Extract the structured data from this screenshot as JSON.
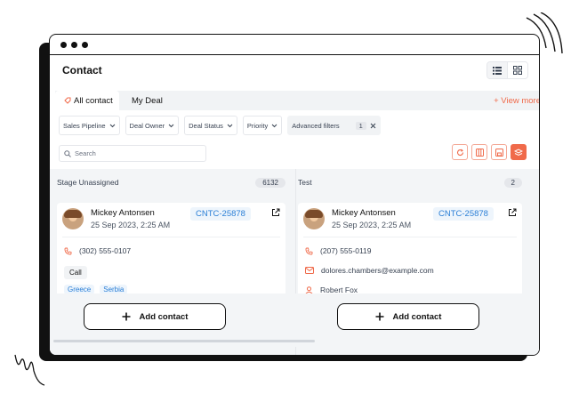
{
  "window": {
    "title": "Contact"
  },
  "tabs": [
    {
      "label": "All contact",
      "active": true
    },
    {
      "label": "My Deal",
      "active": false
    }
  ],
  "view_more": "+ View more",
  "filters": [
    {
      "label": "Sales Pipeline"
    },
    {
      "label": "Deal Owner"
    },
    {
      "label": "Deal Status"
    },
    {
      "label": "Priority"
    }
  ],
  "advanced_filters": {
    "label": "Advanced filters",
    "count": "1"
  },
  "search": {
    "placeholder": "Search"
  },
  "columns": [
    {
      "title": "Stage Unassigned",
      "count": "6132",
      "card": {
        "name": "Mickey Antonsen",
        "date": "25 Sep 2023, 2:25 AM",
        "id": "CNTC-25878",
        "phone": "(302) 555-0107",
        "chip": "Call",
        "tags": [
          "Greece",
          "Serbia"
        ]
      },
      "add_label": "Add contact"
    },
    {
      "title": "Test",
      "count": "2",
      "card": {
        "name": "Mickey Antonsen",
        "date": "25 Sep 2023, 2:25 AM",
        "id": "CNTC-25878",
        "phone": "(207) 555-0119",
        "email": "dolores.chambers@example.com",
        "person": "Robert Fox"
      },
      "add_label": "Add contact"
    }
  ],
  "colors": {
    "accent": "#f06a4a",
    "link": "#2b7fd6",
    "border": "#111111"
  }
}
